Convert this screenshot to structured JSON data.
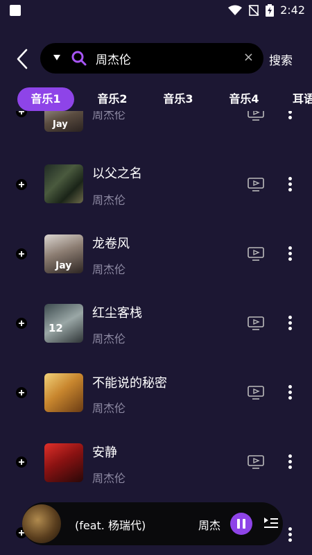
{
  "status": {
    "time": "2:42"
  },
  "search": {
    "query": "周杰伦",
    "button": "搜索",
    "clear_glyph": "×"
  },
  "tabs": [
    "音乐1",
    "音乐2",
    "音乐3",
    "音乐4",
    "耳语"
  ],
  "songs": [
    {
      "title": "",
      "artist": "周杰伦",
      "art_text": "Jay"
    },
    {
      "title": "以父之名",
      "artist": "周杰伦"
    },
    {
      "title": "龙卷风",
      "artist": "周杰伦",
      "art_text": "Jay"
    },
    {
      "title": "红尘客栈",
      "artist": "周杰伦",
      "art_text": "12"
    },
    {
      "title": "不能说的秘密",
      "artist": "周杰伦"
    },
    {
      "title": "安静",
      "artist": "周杰伦"
    }
  ],
  "player": {
    "title": "(feat. 杨瑞代)",
    "artist": "周杰"
  },
  "colors": {
    "background": "#1c1733",
    "accent": "#8e44e8",
    "secondary_text": "#8e8aa3"
  }
}
